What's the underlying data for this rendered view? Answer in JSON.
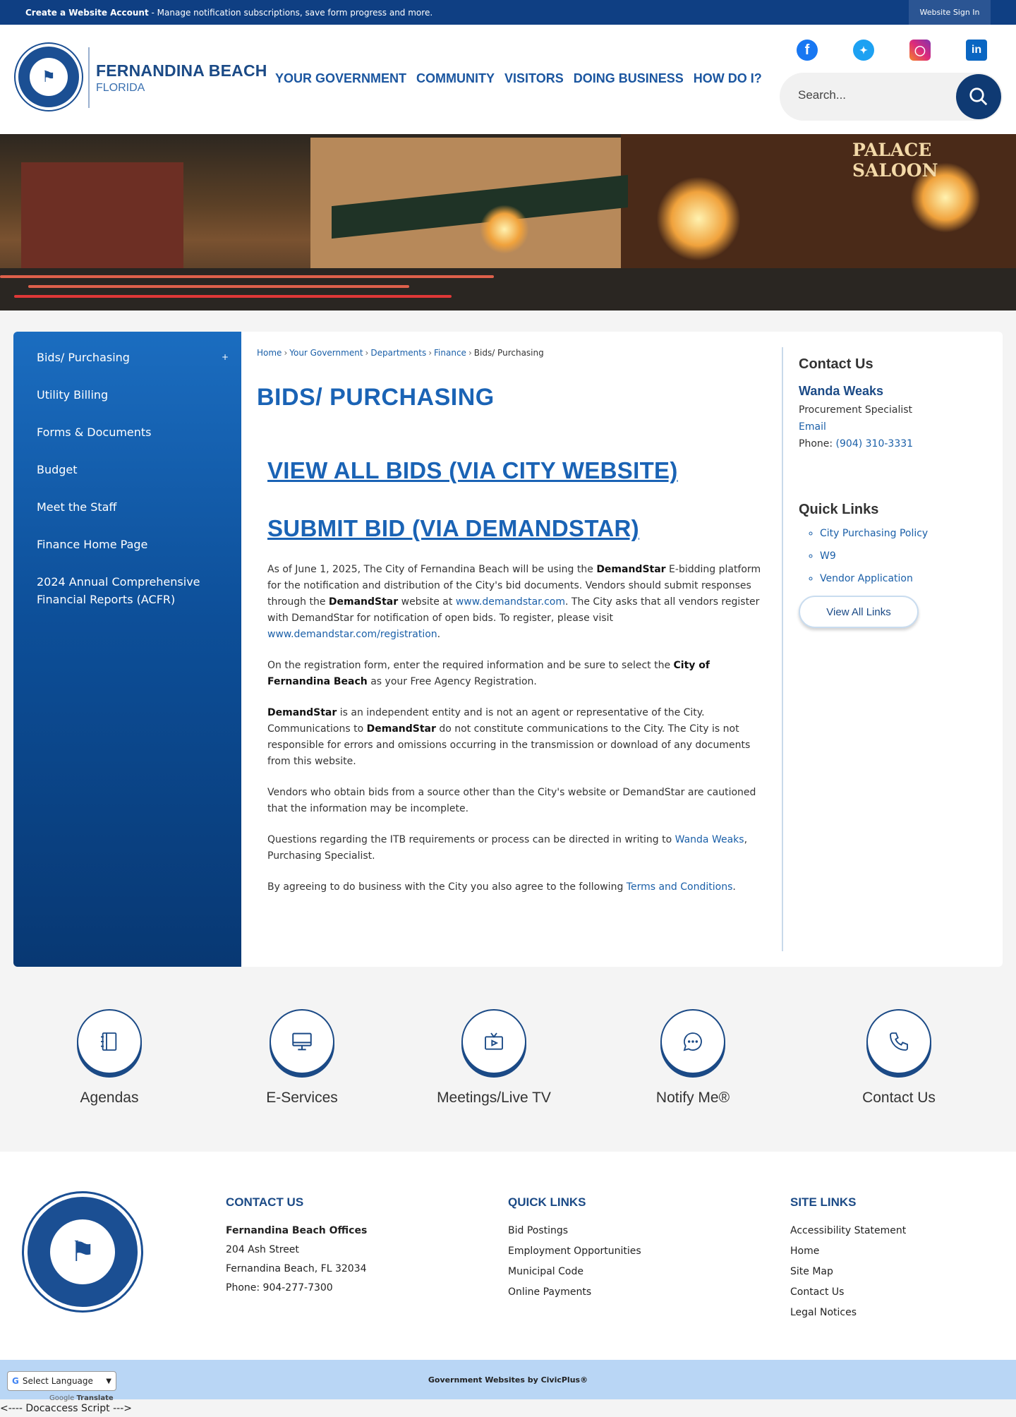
{
  "topbar": {
    "create_account": "Create a Website Account",
    "message": " - Manage notification subscriptions, save form progress and more.",
    "sign_in": "Website Sign In"
  },
  "header": {
    "site_name": "FERNANDINA BEACH",
    "site_state": "FLORIDA",
    "nav": [
      "YOUR GOVERNMENT",
      "COMMUNITY",
      "VISITORS",
      "DOING BUSINESS",
      "HOW DO I?"
    ],
    "search_placeholder": "Search..."
  },
  "banner": {
    "sign_text": "PALACE SALOON"
  },
  "sidebar": {
    "items": [
      {
        "label": "Bids/ Purchasing",
        "toggle": "+"
      },
      {
        "label": "Utility Billing"
      },
      {
        "label": "Forms & Documents"
      },
      {
        "label": "Budget"
      },
      {
        "label": "Meet the Staff"
      },
      {
        "label": "Finance Home Page"
      },
      {
        "label": "2024 Annual Comprehensive Financial Reports (ACFR)"
      }
    ]
  },
  "breadcrumb": {
    "home": "Home",
    "gov": "Your Government",
    "depts": "Departments",
    "finance": "Finance",
    "current": "Bids/ Purchasing",
    "sep": "›"
  },
  "main": {
    "title": "BIDS/ PURCHASING",
    "link1": "VIEW ALL BIDS (VIA CITY WEBSITE)",
    "link2": "SUBMIT BID (VIA DEMANDSTAR)",
    "p1a": "As of June 1, 2025, The City of Fernandina Beach will be using the ",
    "p1b": "DemandStar",
    "p1c": " E-bidding platform for the notification and distribution of the City's bid documents.  Vendors should submit responses through the ",
    "p1d": "DemandStar",
    "p1e": " website at ",
    "p1_link": "www.demandstar.com",
    "p1f": ".  The City asks that all vendors register with DemandStar for notification of open bids. To register, please visit ",
    "p1_link2": "www.demandstar.com/registration",
    "p1g": ".",
    "p2a": "On the registration form, enter the required information and be sure to select the ",
    "p2b": "City of Fernandina Beach",
    "p2c": " as your Free Agency Registration.",
    "p3a": "DemandStar",
    "p3b": " is an independent entity and is not an agent or representative of the City. Communications to ",
    "p3c": "DemandStar",
    "p3d": " do not constitute communications to the City. The City is not responsible for errors and omissions occurring in the transmission or download of any documents from this website.",
    "p4": "Vendors who obtain bids from a source other than the City's website or DemandStar are cautioned that the information may be incomplete.",
    "p5a": "Questions regarding the ITB requirements or process can be directed in writing to ",
    "p5_link": "Wanda Weaks",
    "p5b": ", Purchasing Specialist.",
    "p6a": "By agreeing to do business with the City you also agree to the following ",
    "p6_link": "Terms and Conditions",
    "p6b": "."
  },
  "contact": {
    "heading": "Contact Us",
    "name": "Wanda Weaks",
    "role": "Procurement Specialist",
    "email": "Email",
    "phone_label": "Phone: ",
    "phone": "(904) 310-3331"
  },
  "quick_links": {
    "heading": "Quick Links",
    "items": [
      "City Purchasing Policy",
      "W9",
      "Vendor Application"
    ],
    "view_all": "View All Links"
  },
  "icons": [
    {
      "label": "Agendas",
      "icon": "notebook-icon"
    },
    {
      "label": "E-Services",
      "icon": "monitor-icon"
    },
    {
      "label": "Meetings/Live TV",
      "icon": "tv-icon"
    },
    {
      "label": "Notify Me®",
      "icon": "chat-bubble-icon"
    },
    {
      "label": "Contact Us",
      "icon": "phone-icon"
    }
  ],
  "footer": {
    "contact_heading": "CONTACT US",
    "office": "Fernandina Beach Offices",
    "address1": "204 Ash Street",
    "address2": "Fernandina Beach, FL 32034",
    "phone": "Phone: 904-277-7300",
    "quick_heading": "QUICK LINKS",
    "quick": [
      "Bid Postings",
      "Employment Opportunities",
      "Municipal Code",
      "Online Payments"
    ],
    "site_heading": "SITE LINKS",
    "site": [
      "Accessibility Statement",
      "Home",
      "Site Map",
      "Contact Us",
      "Legal Notices"
    ]
  },
  "bottom": {
    "credit": "Government Websites by CivicPlus®",
    "language": "Select Language",
    "powered": "Google",
    "translate": "Translate",
    "docaccess": "<---- Docaccess Script --->"
  },
  "colors": {
    "topbar": "#0f3f83",
    "accent": "#1a63b5",
    "navy": "#1b4a86",
    "footer_bar": "#b9d6f5"
  }
}
